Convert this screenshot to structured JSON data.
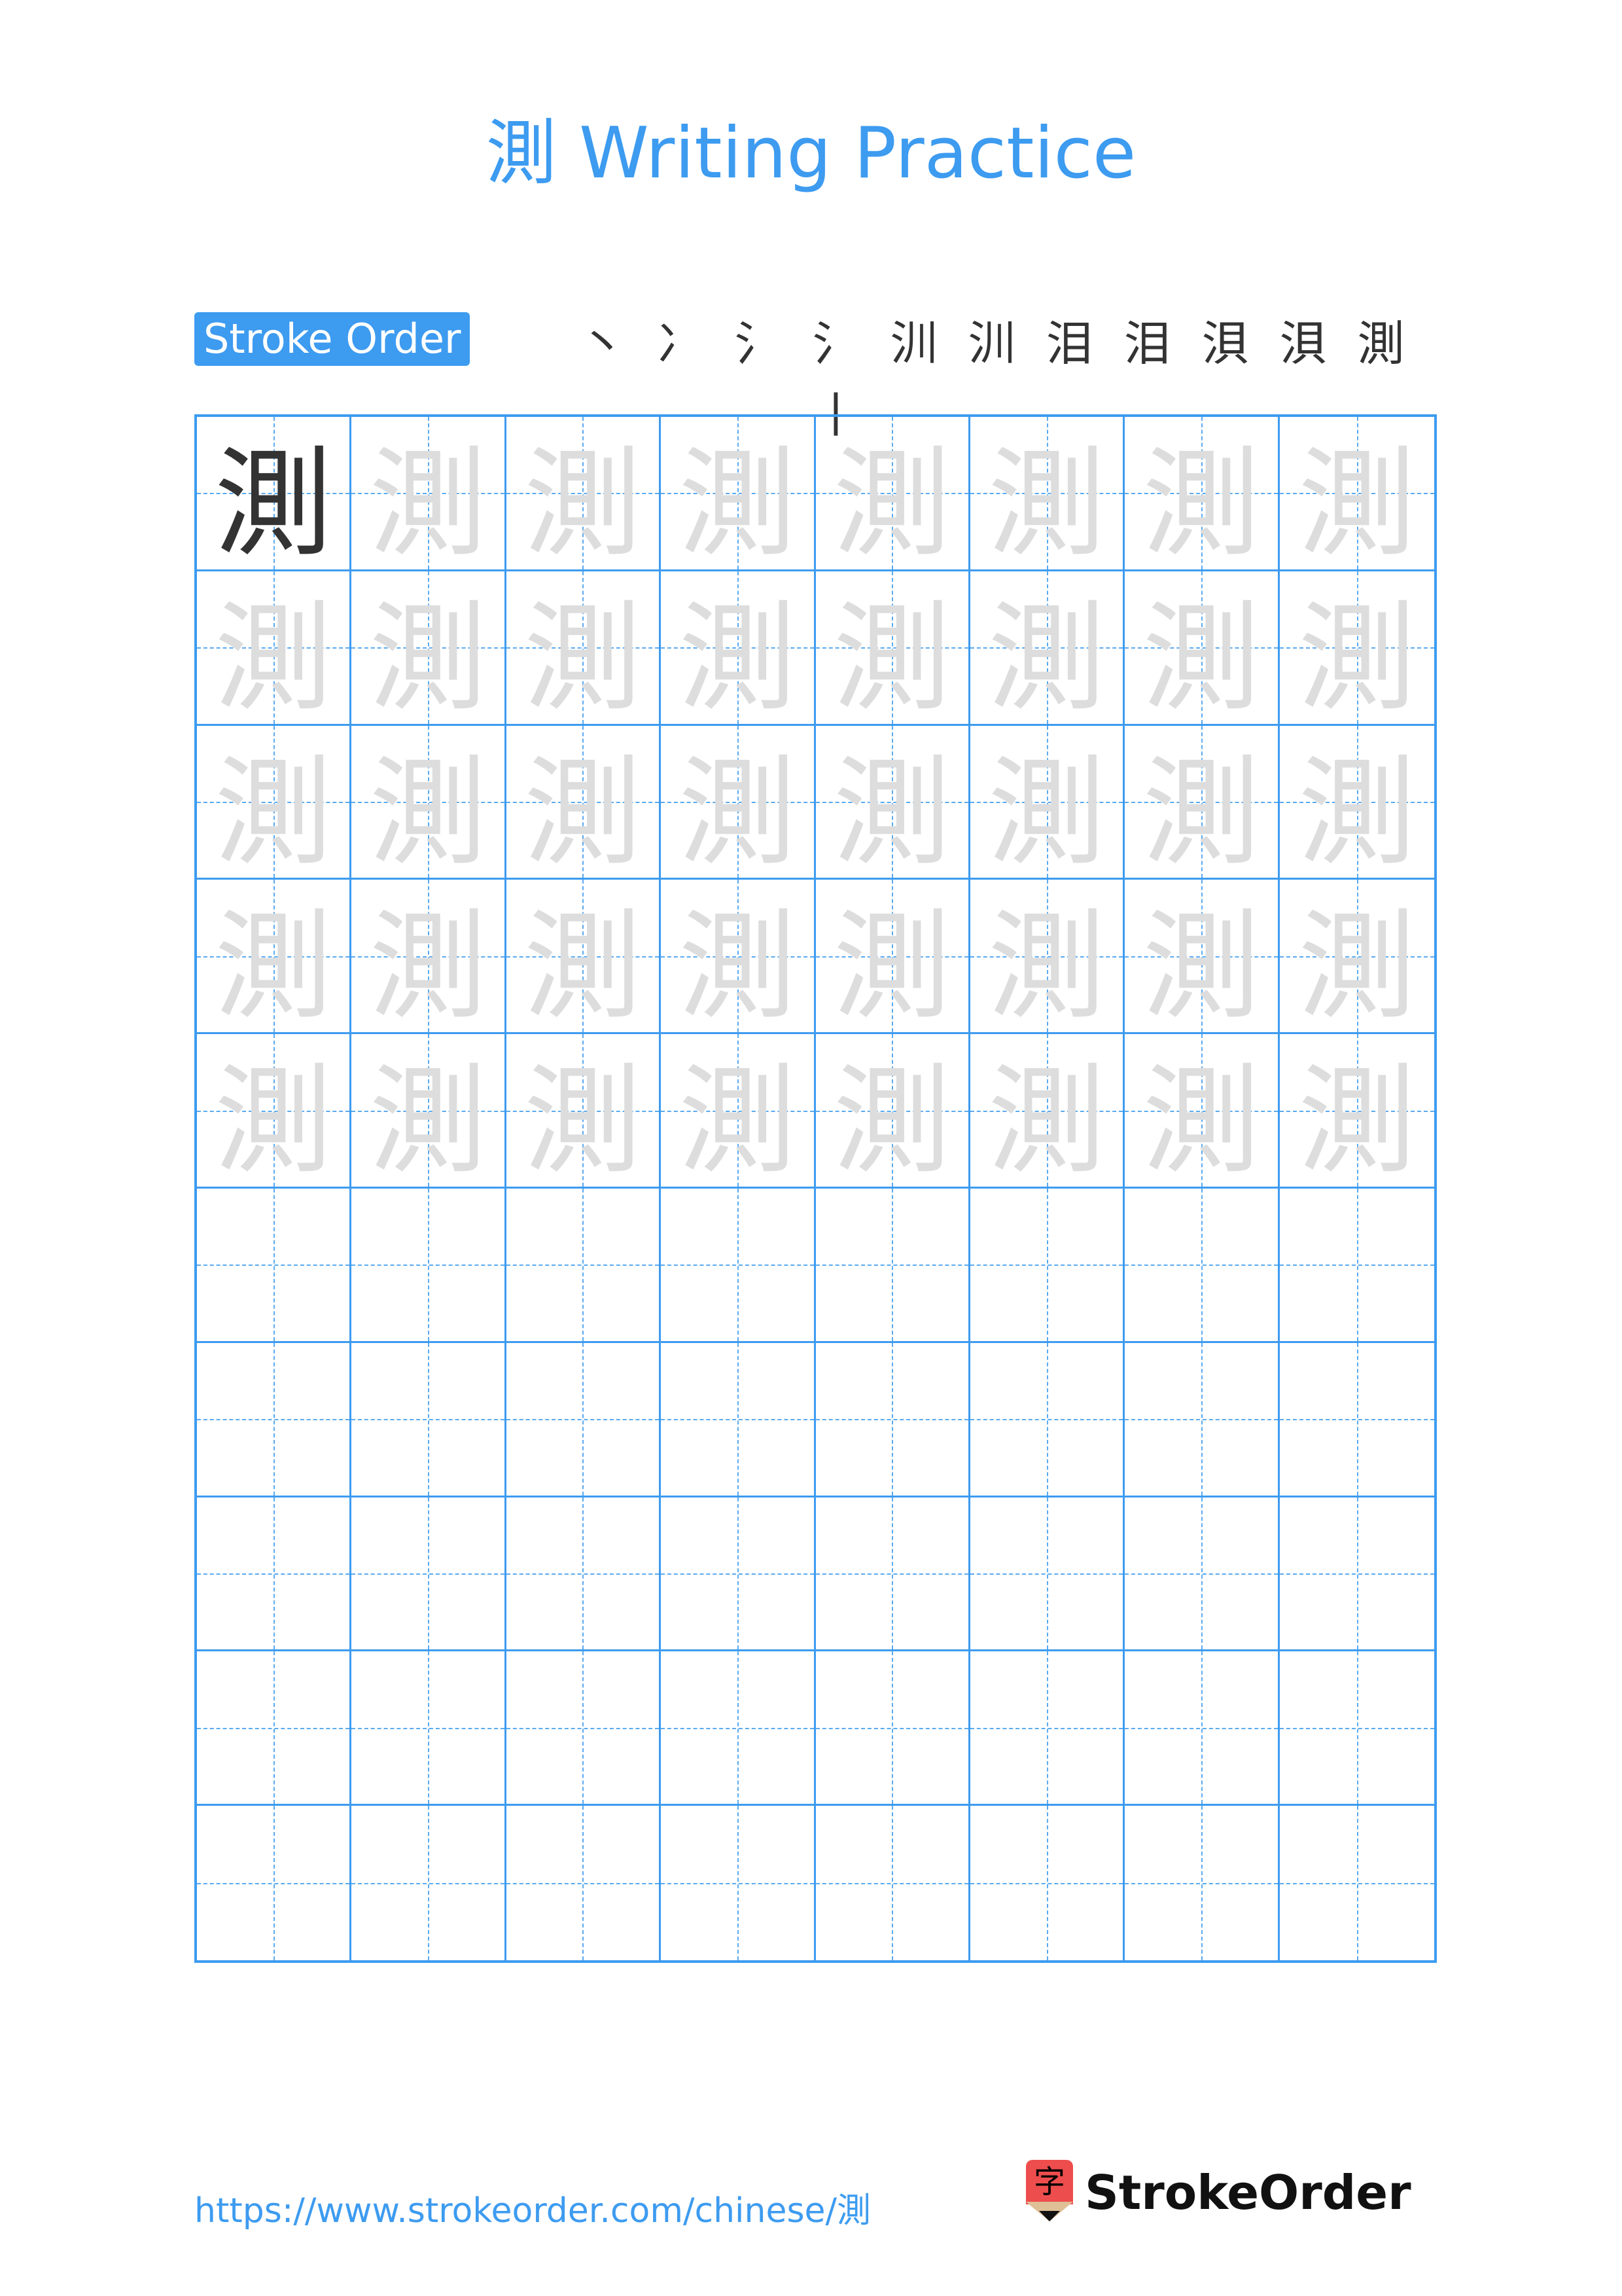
{
  "page": {
    "title": "測 Writing Practice",
    "character": "測"
  },
  "stroke_order": {
    "label": "Stroke Order",
    "steps": [
      {
        "partial": "",
        "new": "丶"
      },
      {
        "partial": "丶",
        "new": "丶"
      },
      {
        "partial": "冫",
        "new": "丿"
      },
      {
        "partial": "氵",
        "new": "丨"
      },
      {
        "partial": "氵丨",
        "new": "𠃌"
      },
      {
        "partial": "汌",
        "new": "一"
      },
      {
        "partial": "汌",
        "new": "一"
      },
      {
        "partial": "泪",
        "new": "一"
      },
      {
        "partial": "泪",
        "new": "丿"
      },
      {
        "partial": "浿",
        "new": "丶"
      },
      {
        "partial": "浿",
        "new": "丨"
      },
      {
        "partial": "測",
        "new": "亅"
      }
    ],
    "new_stroke_color": "#ee0000",
    "drawn_stroke_color": "#333333"
  },
  "grid": {
    "columns": 8,
    "rows": 10,
    "model_cells": 1,
    "trace_rows": 5,
    "line_color": "#3d9bf0",
    "trace_color": "#dddddd",
    "model_color": "#333333"
  },
  "footer": {
    "url": "https://www.strokeorder.com/chinese/測",
    "logo_text": "StrokeOrder",
    "logo_glyph": "字"
  },
  "colors": {
    "accent": "#3d9bf0",
    "logo_red": "#ee4d4d"
  }
}
